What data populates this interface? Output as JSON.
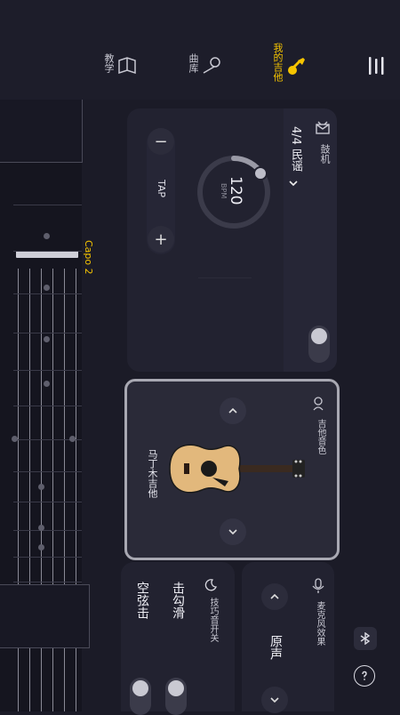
{
  "nav": {
    "my_guitar": "我的吉他",
    "songs": "曲库",
    "tutorial": "教学"
  },
  "capo": {
    "label": "Capo",
    "value": "2"
  },
  "metronome": {
    "title": "鼓机",
    "style": "4/4 民谣",
    "bpm": "120",
    "bpm_unit": "BPM",
    "tap": "TAP",
    "minus": "−",
    "plus": "+"
  },
  "tone": {
    "title": "吉他音色",
    "instrument": "马丁木吉他"
  },
  "mic": {
    "title": "麦克风效果",
    "value": "原声"
  },
  "technique": {
    "title": "技巧音开关",
    "items": [
      "击勾滑",
      "空弦击"
    ]
  },
  "colors": {
    "accent": "#f5c400",
    "bg": "#1b1b27",
    "card": "#222230"
  }
}
